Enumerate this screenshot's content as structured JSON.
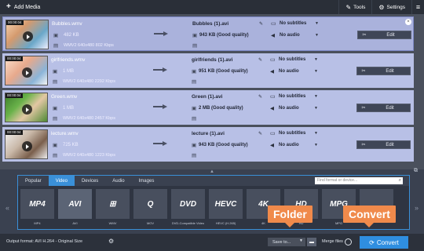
{
  "toolbar": {
    "add_media": "Add Media",
    "tools": "Tools",
    "settings": "Settings",
    "menu_icon": "hamburger-icon"
  },
  "files": [
    {
      "duration": "00:00:04",
      "name": "Bubbles.wmv",
      "size": "482 KB",
      "info": "WMV2 640x480 802 Kbps",
      "out_name": "Bubbles (1).avi",
      "out_size": "943 KB (Good quality)",
      "subtitles": "No subtitles",
      "audio": "No audio",
      "edit": "Edit"
    },
    {
      "duration": "00:00:04",
      "name": "girlfriends.wmv",
      "size": "1 MB",
      "info": "WMV2 640x480 2292 Kbps",
      "out_name": "girlfriends (1).avi",
      "out_size": "951 KB (Good quality)",
      "subtitles": "No subtitles",
      "audio": "No audio",
      "edit": "Edit"
    },
    {
      "duration": "00:00:04",
      "name": "Green.wmv",
      "size": "1 MB",
      "info": "WMV2 640x480 2457 Kbps",
      "out_name": "Green (1).avi",
      "out_size": "2 MB (Good quality)",
      "subtitles": "No subtitles",
      "audio": "No audio",
      "edit": "Edit"
    },
    {
      "duration": "00:00:04",
      "name": "lecture.wmv",
      "size": "725 KB",
      "info": "WMV2 640x480 1223 Kbps",
      "out_name": "lecture (1).avi",
      "out_size": "943 KB (Good quality)",
      "subtitles": "No subtitles",
      "audio": "No audio",
      "edit": "Edit"
    }
  ],
  "tabs": [
    {
      "label": "Popular"
    },
    {
      "label": "Video",
      "active": true
    },
    {
      "label": "Devices"
    },
    {
      "label": "Audio"
    },
    {
      "label": "Images"
    }
  ],
  "search": {
    "placeholder": "Find format or device..."
  },
  "formats": [
    {
      "icon_text": "MP4",
      "label": "MP4"
    },
    {
      "icon_text": "AVI",
      "label": "AVI",
      "active": true
    },
    {
      "icon_text": "⊞",
      "label": "WMV"
    },
    {
      "icon_text": "Q",
      "label": "MOV"
    },
    {
      "icon_text": "DVD",
      "label": "DVD-Compatible Video"
    },
    {
      "icon_text": "HEVC",
      "label": "HEVC (H.265)"
    },
    {
      "icon_text": "4K",
      "label": "4K"
    },
    {
      "icon_text": "HD",
      "label": "HD"
    },
    {
      "icon_text": "MPG",
      "label": "MPG"
    },
    {
      "icon_text": "",
      "label": ""
    }
  ],
  "bottom": {
    "output_format": "Output format: AVI H.264 - Original Size",
    "save_to": "Save to...",
    "merge_files": "Merge files",
    "convert": "Convert"
  },
  "callouts": {
    "folder": "Folder",
    "convert": "Convert"
  },
  "colors": {
    "accent": "#3a90d8",
    "callout": "#f08a4b",
    "convert": "#2f8ee0"
  }
}
